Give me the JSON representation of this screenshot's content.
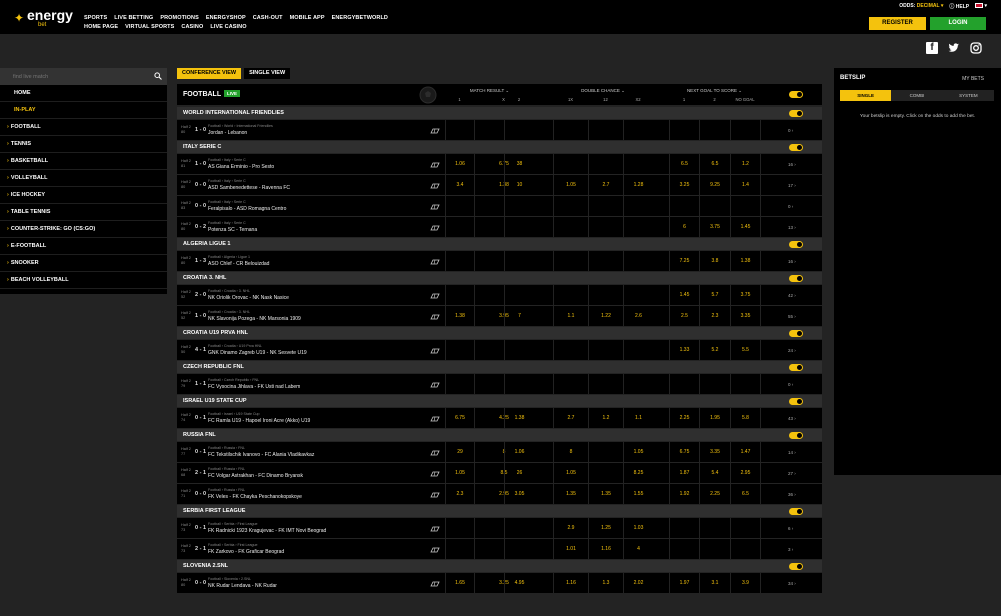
{
  "header": {
    "logo": {
      "line1": "energy",
      "line2": "bet"
    },
    "nav_top": [
      "SPORTS",
      "LIVE BETTING",
      "PROMOTIONS",
      "ENERGYSHOP",
      "CASH-OUT",
      "MOBILE APP",
      "ENERGYBETWORLD"
    ],
    "nav_bottom": [
      "HOME PAGE",
      "VIRTUAL SPORTS",
      "CASINO",
      "LIVE CASINO"
    ],
    "odds_label": "ODDS:",
    "odds_value": "DECIMAL",
    "help": "HELP",
    "register": "REGISTER",
    "login": "LOGIN"
  },
  "social": [
    "f",
    "t",
    "ig"
  ],
  "sidebar": {
    "search_placeholder": "find live match",
    "home": "HOME",
    "inplay": "IN-PLAY",
    "sports": [
      "FOOTBALL",
      "TENNIS",
      "BASKETBALL",
      "VOLLEYBALL",
      "ICE HOCKEY",
      "TABLE TENNIS",
      "COUNTER-STRIKE: GO (CS:GO)",
      "E-FOOTBALL",
      "SNOOKER",
      "BEACH VOLLEYBALL"
    ]
  },
  "main": {
    "view_tabs": [
      "CONFERENCE VIEW",
      "SINGLE VIEW"
    ],
    "sport": "FOOTBALL",
    "live": "LIVE",
    "markets": [
      {
        "title": "MATCH RESULT ⌄",
        "subs": [
          "1",
          "X",
          "2"
        ]
      },
      {
        "title": "DOUBLE CHANCE ⌄",
        "subs": [
          "1X",
          "12",
          "X2"
        ]
      },
      {
        "title": "NEXT GOAL TO SCORE ⌄",
        "subs": [
          "1",
          "2",
          "NO GOAL"
        ]
      }
    ],
    "leagues": [
      {
        "name": "WORLD INTERNATIONAL FRIENDLIES",
        "matches": [
          {
            "half": "Half 2",
            "min": "80",
            "score": "1 - 0",
            "path": "Football › World › International Friendlies",
            "teams": "Jordan - Lebanon",
            "odds": [
              "",
              "",
              "",
              "",
              "",
              "",
              "",
              "",
              ""
            ],
            "more": "0 ›"
          }
        ]
      },
      {
        "name": "ITALY SERIE C",
        "matches": [
          {
            "half": "Half 2",
            "min": "81",
            "score": "1 - 0",
            "path": "Football › Italy › Serie C",
            "teams": "AS Giana Erminio - Pro Sesto",
            "odds": [
              "1.06",
              "6.75",
              "38",
              "",
              "",
              "",
              "6.5",
              "6.5",
              "1.2"
            ],
            "more": "16 ›"
          },
          {
            "half": "Half 2",
            "min": "80",
            "score": "0 - 0",
            "path": "Football › Italy › Serie C",
            "teams": "ASD Sambenedettese - Ravenna FC",
            "odds": [
              "3.4",
              "1.38",
              "10",
              "1.05",
              "2.7",
              "1.28",
              "3.25",
              "9.25",
              "1.4"
            ],
            "more": "17 ›"
          },
          {
            "half": "Half 2",
            "min": "83",
            "score": "0 - 0",
            "path": "Football › Italy › Serie C",
            "teams": "Feralpisalo - ASD Romagna Centro",
            "odds": [
              "",
              "",
              "",
              "",
              "",
              "",
              "",
              "",
              ""
            ],
            "more": "0 ›"
          },
          {
            "half": "Half 2",
            "min": "80",
            "score": "0 - 2",
            "path": "Football › Italy › Serie C",
            "teams": "Potenza SC - Ternana",
            "odds": [
              "",
              "",
              "",
              "",
              "",
              "",
              "6",
              "3.75",
              "1.45"
            ],
            "more": "13 ›"
          }
        ]
      },
      {
        "name": "ALGERIA LIGUE 1",
        "matches": [
          {
            "half": "Half 2",
            "min": "80",
            "score": "1 - 3",
            "path": "Football › Algeria › Ligue 1",
            "teams": "ASO Chlef - CR Belouizdad",
            "odds": [
              "",
              "",
              "",
              "",
              "",
              "",
              "7.25",
              "3.8",
              "1.38"
            ],
            "more": "16 ›"
          }
        ]
      },
      {
        "name": "CROATIA 3. NHL",
        "matches": [
          {
            "half": "Half 2",
            "min": "52",
            "score": "2 - 0",
            "path": "Football › Croatia › 3. NHL",
            "teams": "NK Oriolik Orovac - NK Nask Nasice",
            "odds": [
              "",
              "",
              "",
              "",
              "",
              "",
              "1.45",
              "5.7",
              "3.75"
            ],
            "more": "42 ›"
          },
          {
            "half": "Half 2",
            "min": "52",
            "score": "1 - 0",
            "path": "Football › Croatia › 3. NHL",
            "teams": "NK Slavonija Pozega - NK Marsonia 1909",
            "odds": [
              "1.38",
              "3.95",
              "7",
              "1.1",
              "1.22",
              "2.6",
              "2.5",
              "2.3",
              "3.35"
            ],
            "more": "55 ›"
          }
        ]
      },
      {
        "name": "CROATIA U19 PRVA HNL",
        "matches": [
          {
            "half": "Half 2",
            "min": "50",
            "score": "4 - 1",
            "path": "Football › Croatia › U19 Prva HNL",
            "teams": "GNK Dinamo Zagreb U19 - NK Sesvete U19",
            "odds": [
              "",
              "",
              "",
              "",
              "",
              "",
              "1.33",
              "5.2",
              "5.5"
            ],
            "more": "24 ›"
          }
        ]
      },
      {
        "name": "CZECH REPUBLIC FNL",
        "matches": [
          {
            "half": "Half 2",
            "min": "79",
            "score": "1 - 1",
            "path": "Football › Czech Republic › FNL",
            "teams": "FC Vysocina Jihlava - FK Usti nad Labem",
            "odds": [
              "",
              "",
              "",
              "",
              "",
              "",
              "",
              "",
              ""
            ],
            "more": "0 ›"
          }
        ]
      },
      {
        "name": "ISRAEL U19 STATE CUP",
        "matches": [
          {
            "half": "Half 2",
            "min": "74",
            "score": "0 - 1",
            "path": "Football › Israel › U19 State Cup",
            "teams": "FC Ramla U19 - Hapoel Ironi Acre (Akko) U19",
            "odds": [
              "6.75",
              "4.25",
              "1.38",
              "2.7",
              "1.2",
              "1.1",
              "2.25",
              "1.95",
              "5.8"
            ],
            "more": "43 ›"
          }
        ]
      },
      {
        "name": "RUSSIA FNL",
        "matches": [
          {
            "half": "Half 2",
            "min": "77",
            "score": "0 - 1",
            "path": "Football › Russia › FNL",
            "teams": "FC Tekstilschik Ivanovo - FC Alania Vladikavkaz",
            "odds": [
              "29",
              "8",
              "1.06",
              "8",
              "",
              "1.05",
              "6.75",
              "3.35",
              "1.47"
            ],
            "more": "14 ›"
          },
          {
            "half": "Half 2",
            "min": "68",
            "score": "2 - 1",
            "path": "Football › Russia › FNL",
            "teams": "FC Volgar Astrakhan - FC Dinamo Bryansk",
            "odds": [
              "1.05",
              "8.5",
              "26",
              "1.05",
              "",
              "8.25",
              "1.87",
              "5.4",
              "2.95"
            ],
            "more": "27 ›"
          },
          {
            "half": "Half 2",
            "min": "71",
            "score": "0 - 0",
            "path": "Football › Russia › FNL",
            "teams": "FK Veles - FK Chayka Peschanokopskoye",
            "odds": [
              "2.3",
              "2.95",
              "3.05",
              "1.35",
              "1.35",
              "1.55",
              "1.92",
              "2.25",
              "6.5"
            ],
            "more": "36 ›"
          }
        ]
      },
      {
        "name": "SERBIA FIRST LEAGUE",
        "matches": [
          {
            "half": "Half 2",
            "min": "73",
            "score": "0 - 1",
            "path": "Football › Serbia › First League",
            "teams": "FK Radnicki 1923 Kragujevac - FK IMT Novi Beograd",
            "odds": [
              "",
              "",
              "",
              "2.9",
              "1.25",
              "1.03",
              "",
              "",
              ""
            ],
            "more": "6 ›"
          },
          {
            "half": "Half 2",
            "min": "73",
            "score": "2 - 1",
            "path": "Football › Serbia › First League",
            "teams": "FK Zarkovo - FK Graficar Beograd",
            "odds": [
              "",
              "",
              "",
              "1.01",
              "1.16",
              "4",
              "",
              "",
              ""
            ],
            "more": "3 ›"
          }
        ]
      },
      {
        "name": "SLOVENIA 2.SNL",
        "matches": [
          {
            "half": "Half 2",
            "min": "80",
            "score": "0 - 0",
            "path": "Football › Slovenia › 2.SNL",
            "teams": "NK Rudar Lendava - NK Rudar",
            "odds": [
              "1.65",
              "3.25",
              "4.95",
              "1.16",
              "1.3",
              "2.02",
              "1.97",
              "3.1",
              "3.9"
            ],
            "more": "34 ›"
          }
        ]
      }
    ]
  },
  "betslip": {
    "title": "BETSLIP",
    "my_bets": "MY BETS",
    "tabs": [
      "SINGLE",
      "COMBI",
      "SYSTEM"
    ],
    "empty": "Your betslip is empty. Click on the odds to add the bet."
  },
  "colors": {
    "accent": "#f4c20d",
    "login": "#23a12c",
    "bg": "#232323",
    "panel": "#000000",
    "league": "#2f2f2f"
  }
}
